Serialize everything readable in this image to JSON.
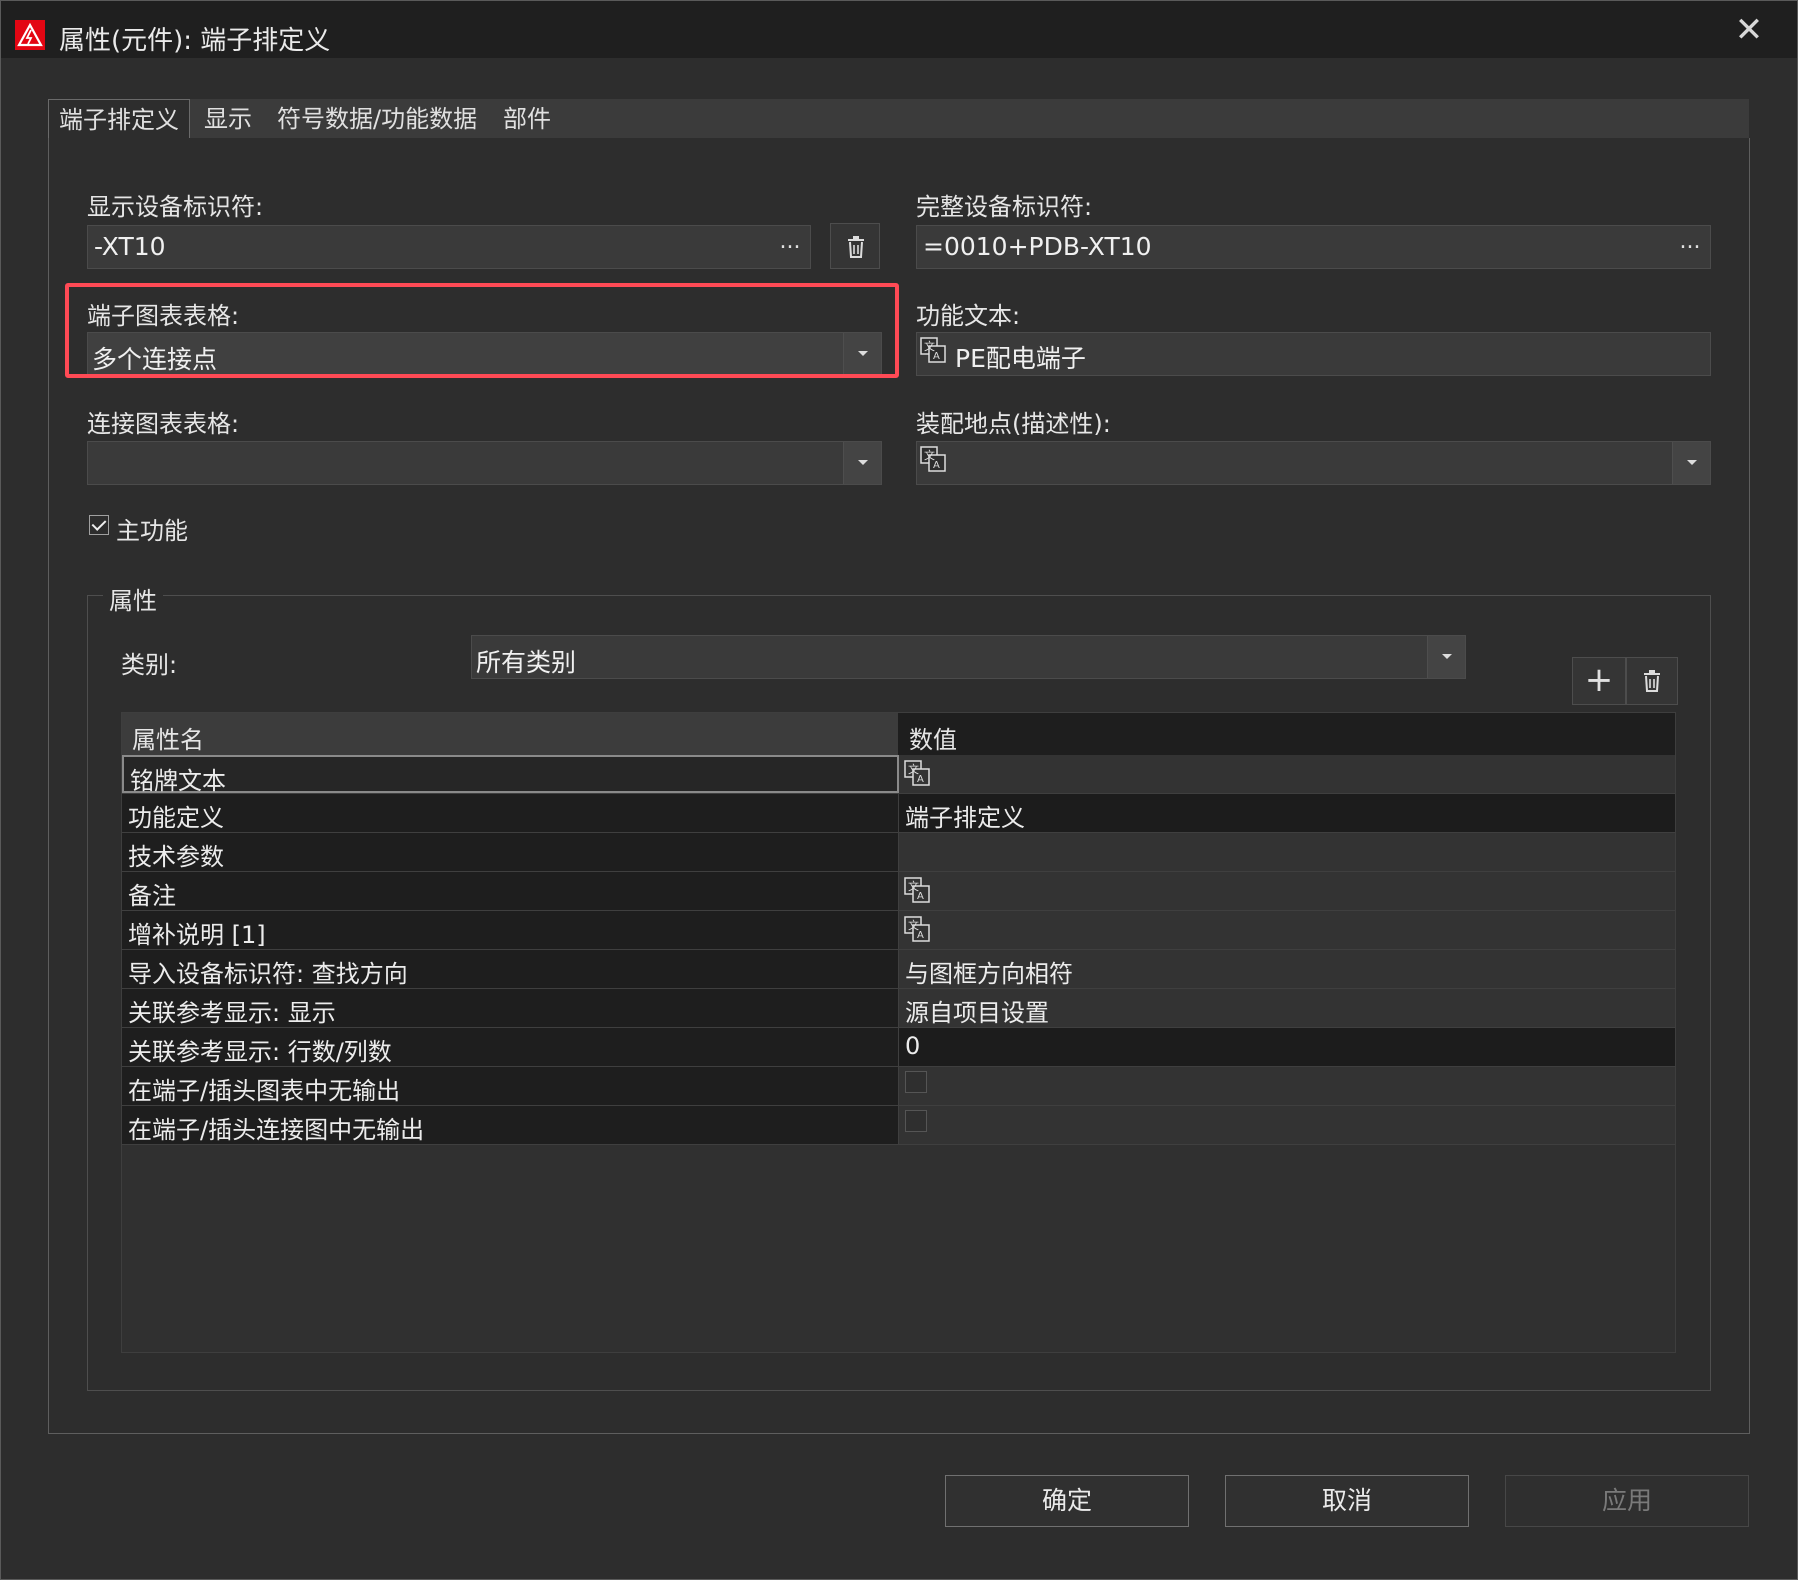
{
  "window": {
    "title": "属性(元件): 端子排定义",
    "close_glyph": "✕"
  },
  "tabs": [
    {
      "label": "端子排定义",
      "active": true
    },
    {
      "label": "显示",
      "active": false
    },
    {
      "label": "符号数据/功能数据",
      "active": false
    },
    {
      "label": "部件",
      "active": false
    }
  ],
  "form": {
    "display_id_label": "显示设备标识符:",
    "display_id_value": "-XT10",
    "full_id_label": "完整设备标识符:",
    "full_id_value": "=0010+PDB-XT10",
    "terminal_chart_label": "端子图表表格:",
    "terminal_chart_value": "多个连接点",
    "function_text_label": "功能文本:",
    "function_text_value": "PE配电端子",
    "connection_chart_label": "连接图表表格:",
    "connection_chart_value": "",
    "mount_location_label": "装配地点(描述性):",
    "mount_location_value": "",
    "main_function_label": "主功能",
    "main_function_checked": true,
    "ellipsis": "..."
  },
  "properties": {
    "group_title": "属性",
    "category_label": "类别:",
    "category_value": "所有类别",
    "add_glyph": "+",
    "header_name": "属性名",
    "header_value": "数值",
    "rows": [
      {
        "name": "铭牌文本",
        "value": "",
        "kind": "translate"
      },
      {
        "name": "功能定义",
        "value": "端子排定义",
        "kind": "text"
      },
      {
        "name": "技术参数",
        "value": "",
        "kind": "text"
      },
      {
        "name": "备注",
        "value": "",
        "kind": "translate"
      },
      {
        "name": "增补说明 [1]",
        "value": "",
        "kind": "translate"
      },
      {
        "name": "导入设备标识符: 查找方向",
        "value": "与图框方向相符",
        "kind": "text"
      },
      {
        "name": "关联参考显示: 显示",
        "value": "源自项目设置",
        "kind": "text"
      },
      {
        "name": "关联参考显示: 行数/列数",
        "value": "0",
        "kind": "text"
      },
      {
        "name": "在端子/插头图表中无输出",
        "value": "",
        "kind": "checkbox"
      },
      {
        "name": "在端子/插头连接图中无输出",
        "value": "",
        "kind": "checkbox"
      }
    ]
  },
  "buttons": {
    "ok": "确定",
    "cancel": "取消",
    "apply": "应用"
  },
  "colors": {
    "highlight": "#ff4a55",
    "brand": "#e30613"
  }
}
